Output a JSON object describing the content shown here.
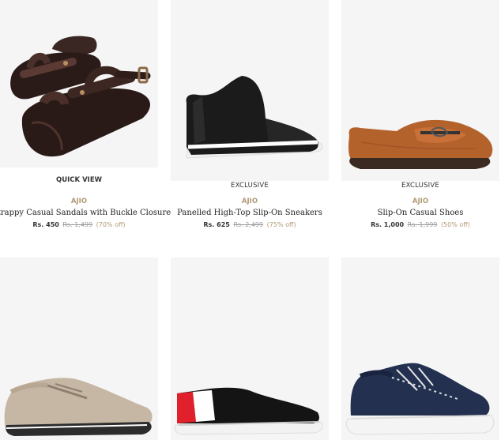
{
  "products": [
    {
      "overlay": "QUICK VIEW",
      "brand": "AJIO",
      "name": "Strappy Casual Sandals with Buckle Closure",
      "price_now": "Rs. 450",
      "price_was": "Rs. 1,499",
      "discount": "(70% off)",
      "image": "brown-sandal"
    },
    {
      "tag": "EXCLUSIVE",
      "brand": "AJIO",
      "name": "Panelled High-Top Slip-On Sneakers",
      "price_now": "Rs. 625",
      "price_was": "Rs. 2,499",
      "discount": "(75% off)",
      "image": "black-high-top-sneaker"
    },
    {
      "tag": "EXCLUSIVE",
      "brand": "AJIO",
      "name": "Slip-On Casual Shoes",
      "price_now": "Rs. 1,000",
      "price_was": "Rs. 1,999",
      "discount": "(50% off)",
      "image": "tan-loafer"
    },
    {
      "image": "beige-derby-shoe"
    },
    {
      "image": "black-slip-on-sneaker"
    },
    {
      "image": "navy-mesh-sneaker"
    }
  ],
  "colors": {
    "accent": "#b19975",
    "card_bg": "#f5f5f5"
  }
}
